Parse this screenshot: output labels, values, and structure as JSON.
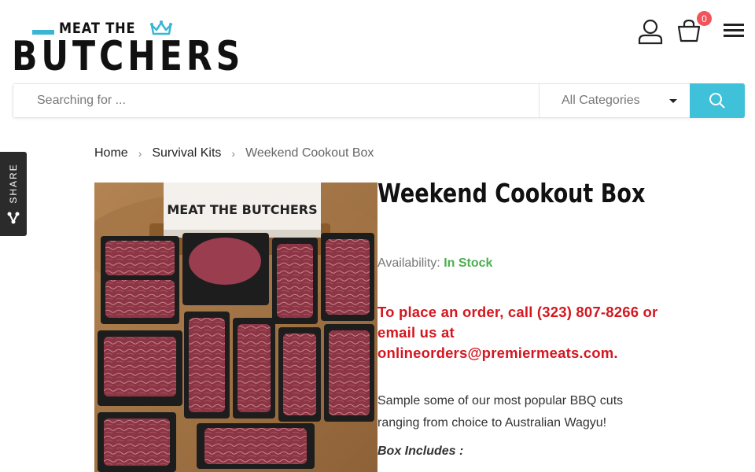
{
  "header": {
    "logo_small": "MEAT THE",
    "logo_big": "BUTCHERS",
    "cart_count": "0"
  },
  "search": {
    "placeholder": "Searching for ...",
    "category": "All Categories"
  },
  "share": {
    "label": "SHARE"
  },
  "breadcrumb": {
    "items": [
      "Home",
      "Survival Kits"
    ],
    "current": "Weekend Cookout Box"
  },
  "product": {
    "title": "Weekend Cookout Box",
    "availability_label": "Availability:",
    "availability_value": "In Stock",
    "order_note": "To place an order, call (323) 807-8266 or email us at onlineorders@premiermeats.com.",
    "description": "Sample some of our most popular BBQ cuts ranging from choice to Australian Wagyu!",
    "includes_heading": "Box Includes :",
    "image_box_label": "MEAT THE BUTCHERS"
  },
  "colors": {
    "accent": "#3ec1d9",
    "badge": "#f2545b",
    "in_stock": "#4caf50",
    "order_note": "#d4161f"
  },
  "icons": [
    "user-icon",
    "cart-icon",
    "menu-icon",
    "search-icon",
    "share-icon",
    "chevron-right-icon",
    "caret-down-icon",
    "crown-icon"
  ]
}
